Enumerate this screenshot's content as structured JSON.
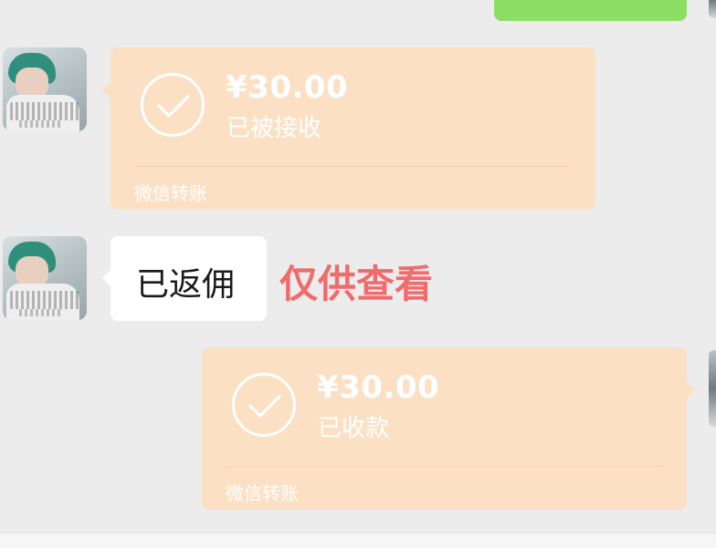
{
  "colors": {
    "background": "#ececec",
    "transfer_card": "#fbe0c4",
    "sent_bubble_green": "#8cde64",
    "caption_red": "#f06b6b"
  },
  "messages": [
    {
      "kind": "transfer",
      "direction": "incoming",
      "amount": "¥30.00",
      "status": "已被接收",
      "footer": "微信转账",
      "icon": "check-circle-icon"
    },
    {
      "kind": "text",
      "direction": "incoming",
      "text": "已返佣"
    },
    {
      "kind": "transfer",
      "direction": "outgoing",
      "amount": "¥30.00",
      "status": "已收款",
      "footer": "微信转账",
      "icon": "check-circle-icon"
    }
  ],
  "overlay_caption": "仅供查看"
}
